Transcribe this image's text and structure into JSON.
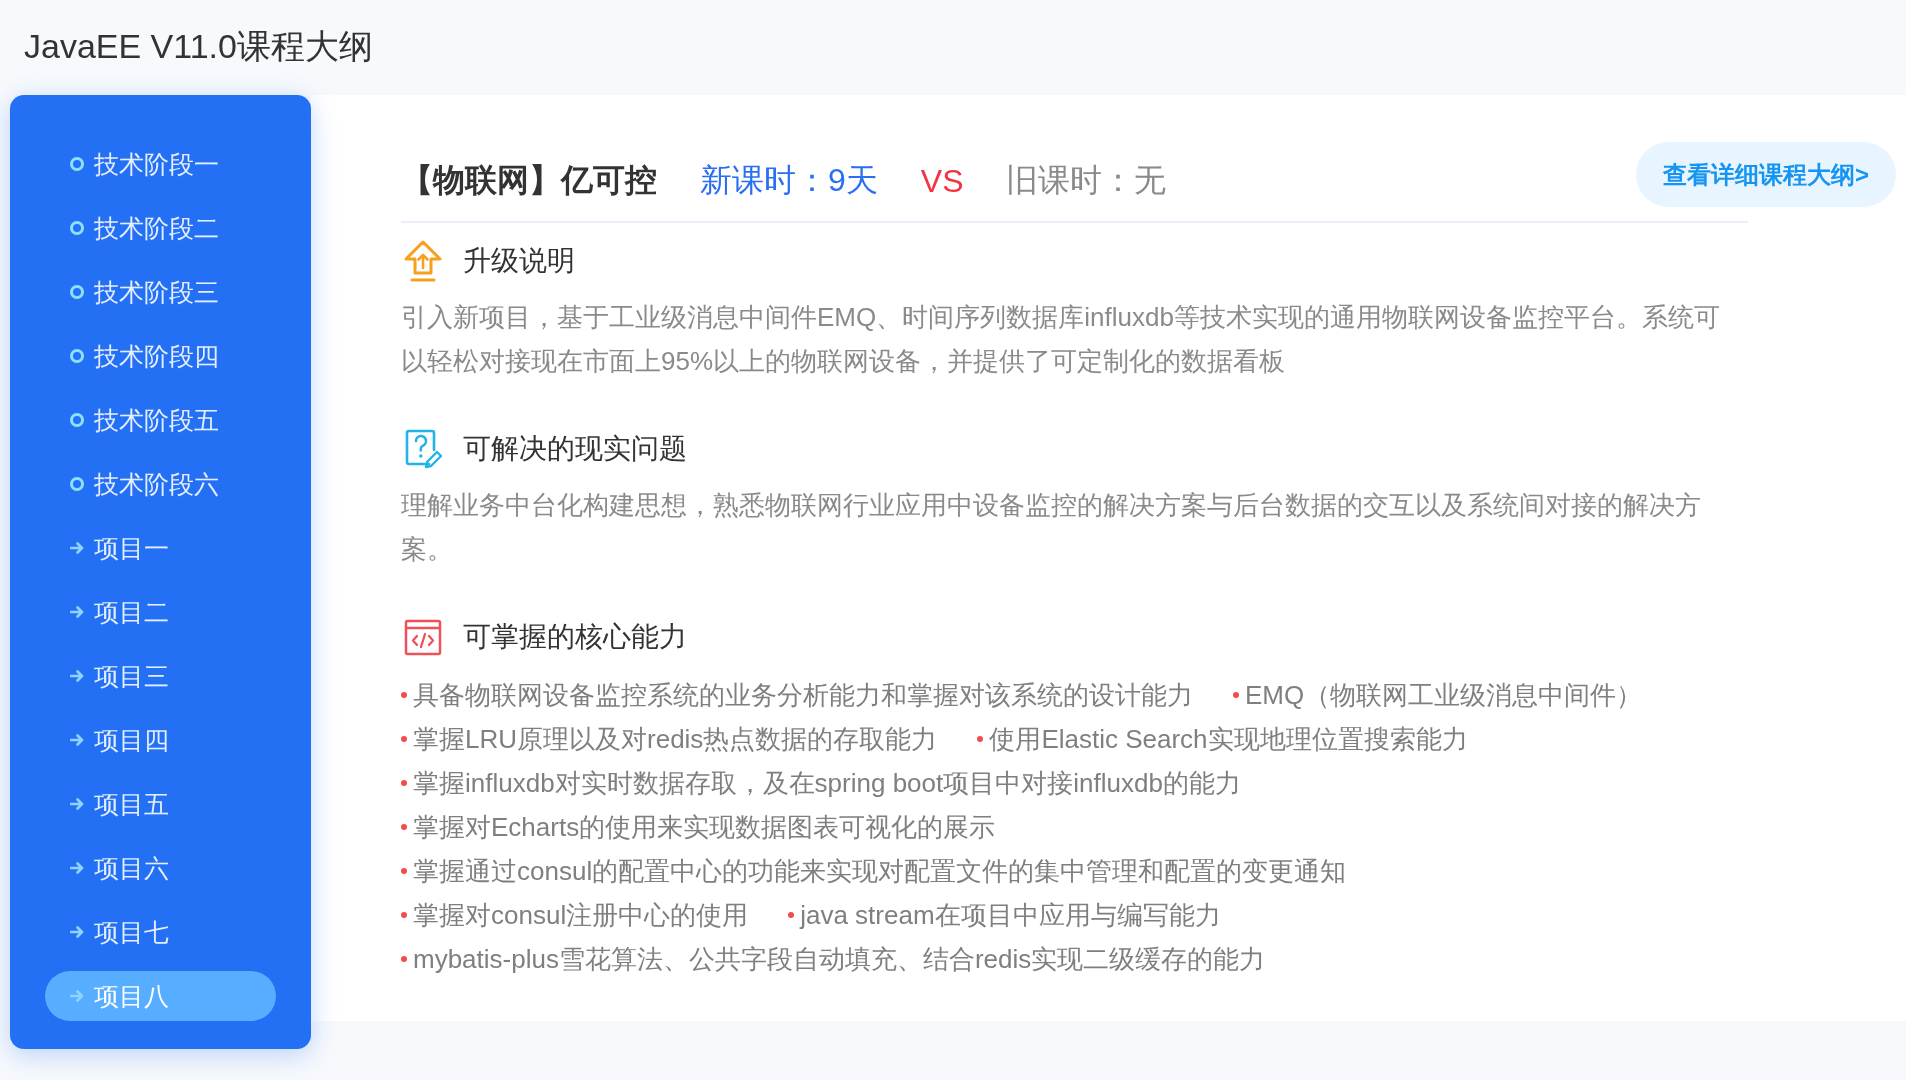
{
  "page": {
    "title": "JavaEE V11.0课程大纲"
  },
  "sidebar": {
    "items": [
      {
        "label": "技术阶段一",
        "kind": "stage",
        "selected": false
      },
      {
        "label": "技术阶段二",
        "kind": "stage",
        "selected": false
      },
      {
        "label": "技术阶段三",
        "kind": "stage",
        "selected": false
      },
      {
        "label": "技术阶段四",
        "kind": "stage",
        "selected": false
      },
      {
        "label": "技术阶段五",
        "kind": "stage",
        "selected": false
      },
      {
        "label": "技术阶段六",
        "kind": "stage",
        "selected": false
      },
      {
        "label": "项目一",
        "kind": "project",
        "selected": false
      },
      {
        "label": "项目二",
        "kind": "project",
        "selected": false
      },
      {
        "label": "项目三",
        "kind": "project",
        "selected": false
      },
      {
        "label": "项目四",
        "kind": "project",
        "selected": false
      },
      {
        "label": "项目五",
        "kind": "project",
        "selected": false
      },
      {
        "label": "项目六",
        "kind": "project",
        "selected": false
      },
      {
        "label": "项目七",
        "kind": "project",
        "selected": false
      },
      {
        "label": "项目八",
        "kind": "project",
        "selected": true
      }
    ]
  },
  "course": {
    "name": "【物联网】亿可控",
    "new_hours": "新课时：9天",
    "versus": "VS",
    "old_hours": "旧课时：无",
    "detail_button": "查看详细课程大纲>",
    "sections": [
      {
        "kind": "upgrade",
        "title": "升级说明",
        "text": "引入新项目，基于工业级消息中间件EMQ、时间序列数据库influxdb等技术实现的通用物联网设备监控平台。系统可以轻松对接现在市面上95%以上的物联网设备，并提供了可定制化的数据看板"
      },
      {
        "kind": "problems",
        "title": "可解决的现实问题",
        "text": "理解业务中台化构建思想，熟悉物联网行业应用中设备监控的解决方案与后台数据的交互以及系统间对接的解决方案。"
      },
      {
        "kind": "skills",
        "title": "可掌握的核心能力",
        "rows": [
          [
            "具备物联网设备监控系统的业务分析能力和掌握对该系统的设计能力",
            "EMQ（物联网工业级消息中间件）"
          ],
          [
            "掌握LRU原理以及对redis热点数据的存取能力",
            "使用Elastic Search实现地理位置搜索能力"
          ],
          [
            "掌握influxdb对实时数据存取，及在spring boot项目中对接influxdb的能力"
          ],
          [
            "掌握对Echarts的使用来实现数据图表可视化的展示"
          ],
          [
            "掌握通过consul的配置中心的功能来实现对配置文件的集中管理和配置的变更通知"
          ],
          [
            "掌握对consul注册中心的使用",
            "java stream在项目中应用与编写能力"
          ],
          [
            "mybatis-plus雪花算法、公共字段自动填充、结合redis实现二级缓存的能力"
          ]
        ]
      }
    ]
  }
}
